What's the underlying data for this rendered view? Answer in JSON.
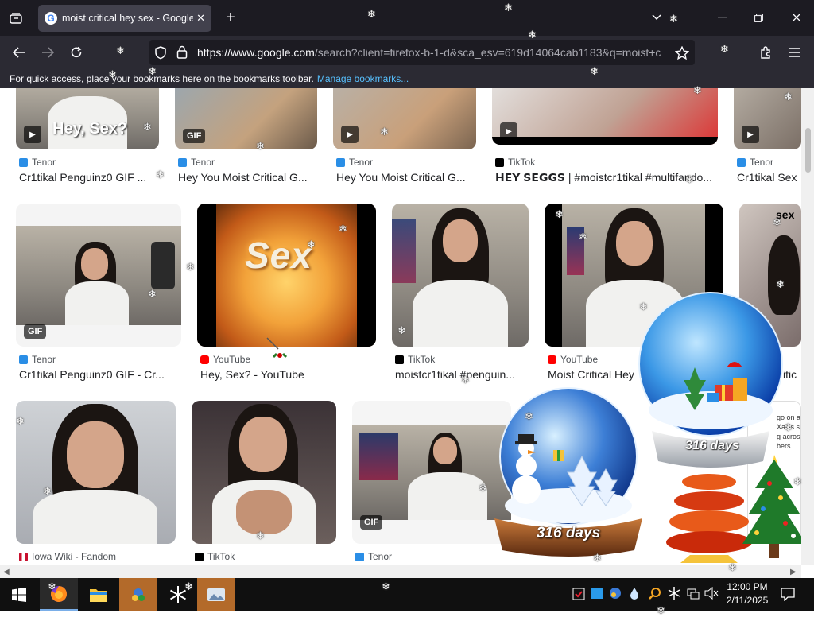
{
  "browser": {
    "tab_title": "moist critical hey sex - Google S",
    "url_host": "https://www.google.com",
    "url_rest": "/search?client=firefox-b-1-d&sca_esv=619d14064cab1183&q=moist+c",
    "bookmarks_text": "For quick access, place your bookmarks here on the bookmarks toolbar.",
    "bookmarks_link": "Manage bookmarks...",
    "icons": [
      "tab-list-icon",
      "new-tab-icon",
      "chevron-down-icon",
      "minimize-icon",
      "maximize-icon",
      "close-window-icon",
      "back-icon",
      "forward-icon",
      "reload-icon",
      "shield-icon",
      "lock-icon",
      "bookmark-star-icon",
      "extensions-icon",
      "menu-icon"
    ]
  },
  "results": {
    "row1": [
      {
        "thumb_text": "Hey, Sex?",
        "badge": "",
        "source": "Tenor",
        "caption": "Cr1tikal Penguinz0 GIF ..."
      },
      {
        "thumb_text": "",
        "badge": "GIF",
        "source": "Tenor",
        "caption": "Hey You Moist Critical G..."
      },
      {
        "thumb_text": "",
        "badge": "",
        "source": "Tenor",
        "caption": "Hey You Moist Critical G..."
      },
      {
        "thumb_text": "",
        "badge": "",
        "source": "TikTok",
        "caption": "𝗛𝗘𝗬 𝗦𝗘𝗚𝗚𝗦 | #moistcr1tikal #multifando..."
      },
      {
        "thumb_text": "",
        "badge": "",
        "source": "Tenor",
        "caption": "Cr1tikal Sex"
      }
    ],
    "row2": [
      {
        "badge": "GIF",
        "source": "Tenor",
        "caption": "Cr1tikal Penguinz0 GIF - Cr..."
      },
      {
        "thumb_text": "Sex",
        "badge": "",
        "source": "YouTube",
        "caption": "Hey, Sex? - YouTube"
      },
      {
        "badge": "",
        "source": "TikTok",
        "caption": "moistcr1tikal #penguin..."
      },
      {
        "badge": "",
        "source": "YouTube",
        "caption": "Moist Critical Hey"
      },
      {
        "thumb_text": "sex",
        "badge": "",
        "source": "",
        "caption": "itic"
      }
    ],
    "row3": [
      {
        "badge": "",
        "source": "Iowa Wiki - Fandom",
        "caption": ""
      },
      {
        "badge": "",
        "source": "TikTok",
        "caption": ""
      },
      {
        "badge": "GIF",
        "source": "Tenor",
        "caption": ""
      }
    ]
  },
  "overlay": {
    "globe_small_days": "316 days",
    "globe_large_days": "316 days",
    "partial_text_lines": [
      "go on an i",
      "Xal is scalin",
      "g across",
      "bers"
    ]
  },
  "taskbar": {
    "time": "12:00 PM",
    "date": "2/11/2025",
    "apps": [
      "start-icon",
      "firefox-icon",
      "file-explorer-icon",
      "app-icon",
      "snowflake-app-icon",
      "photos-icon"
    ]
  },
  "colors": {
    "tab_bg": "#42414d",
    "toolbar_bg": "#2b2a33",
    "link": "#57c1ff",
    "tenor": "#2a8ee6",
    "youtube": "#ff0000",
    "tiktok": "#000000"
  }
}
